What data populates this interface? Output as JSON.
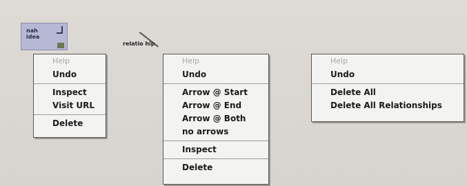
{
  "node": {
    "text": "nah\nidea"
  },
  "relationship": {
    "label": "relatio  hip"
  },
  "menus": {
    "node_menu": {
      "help": "Help",
      "undo": "Undo",
      "inspect": "Inspect",
      "visit_url": "Visit URL",
      "delete": "Delete"
    },
    "relationship_menu": {
      "help": "Help",
      "undo": "Undo",
      "arrow_start": "Arrow @ Start",
      "arrow_end": "Arrow @ End",
      "arrow_both": "Arrow @ Both",
      "no_arrows": "no arrows",
      "inspect": "Inspect",
      "delete": "Delete"
    },
    "background_menu": {
      "help": "Help",
      "undo": "Undo",
      "delete_all": "Delete All",
      "delete_all_relationships": "Delete All Relationships"
    }
  },
  "colors": {
    "background": "#d9d6d1",
    "menu_bg": "#f3f3f1",
    "node_fill": "#b7b7d6",
    "disabled_text": "#a8a8a8"
  }
}
